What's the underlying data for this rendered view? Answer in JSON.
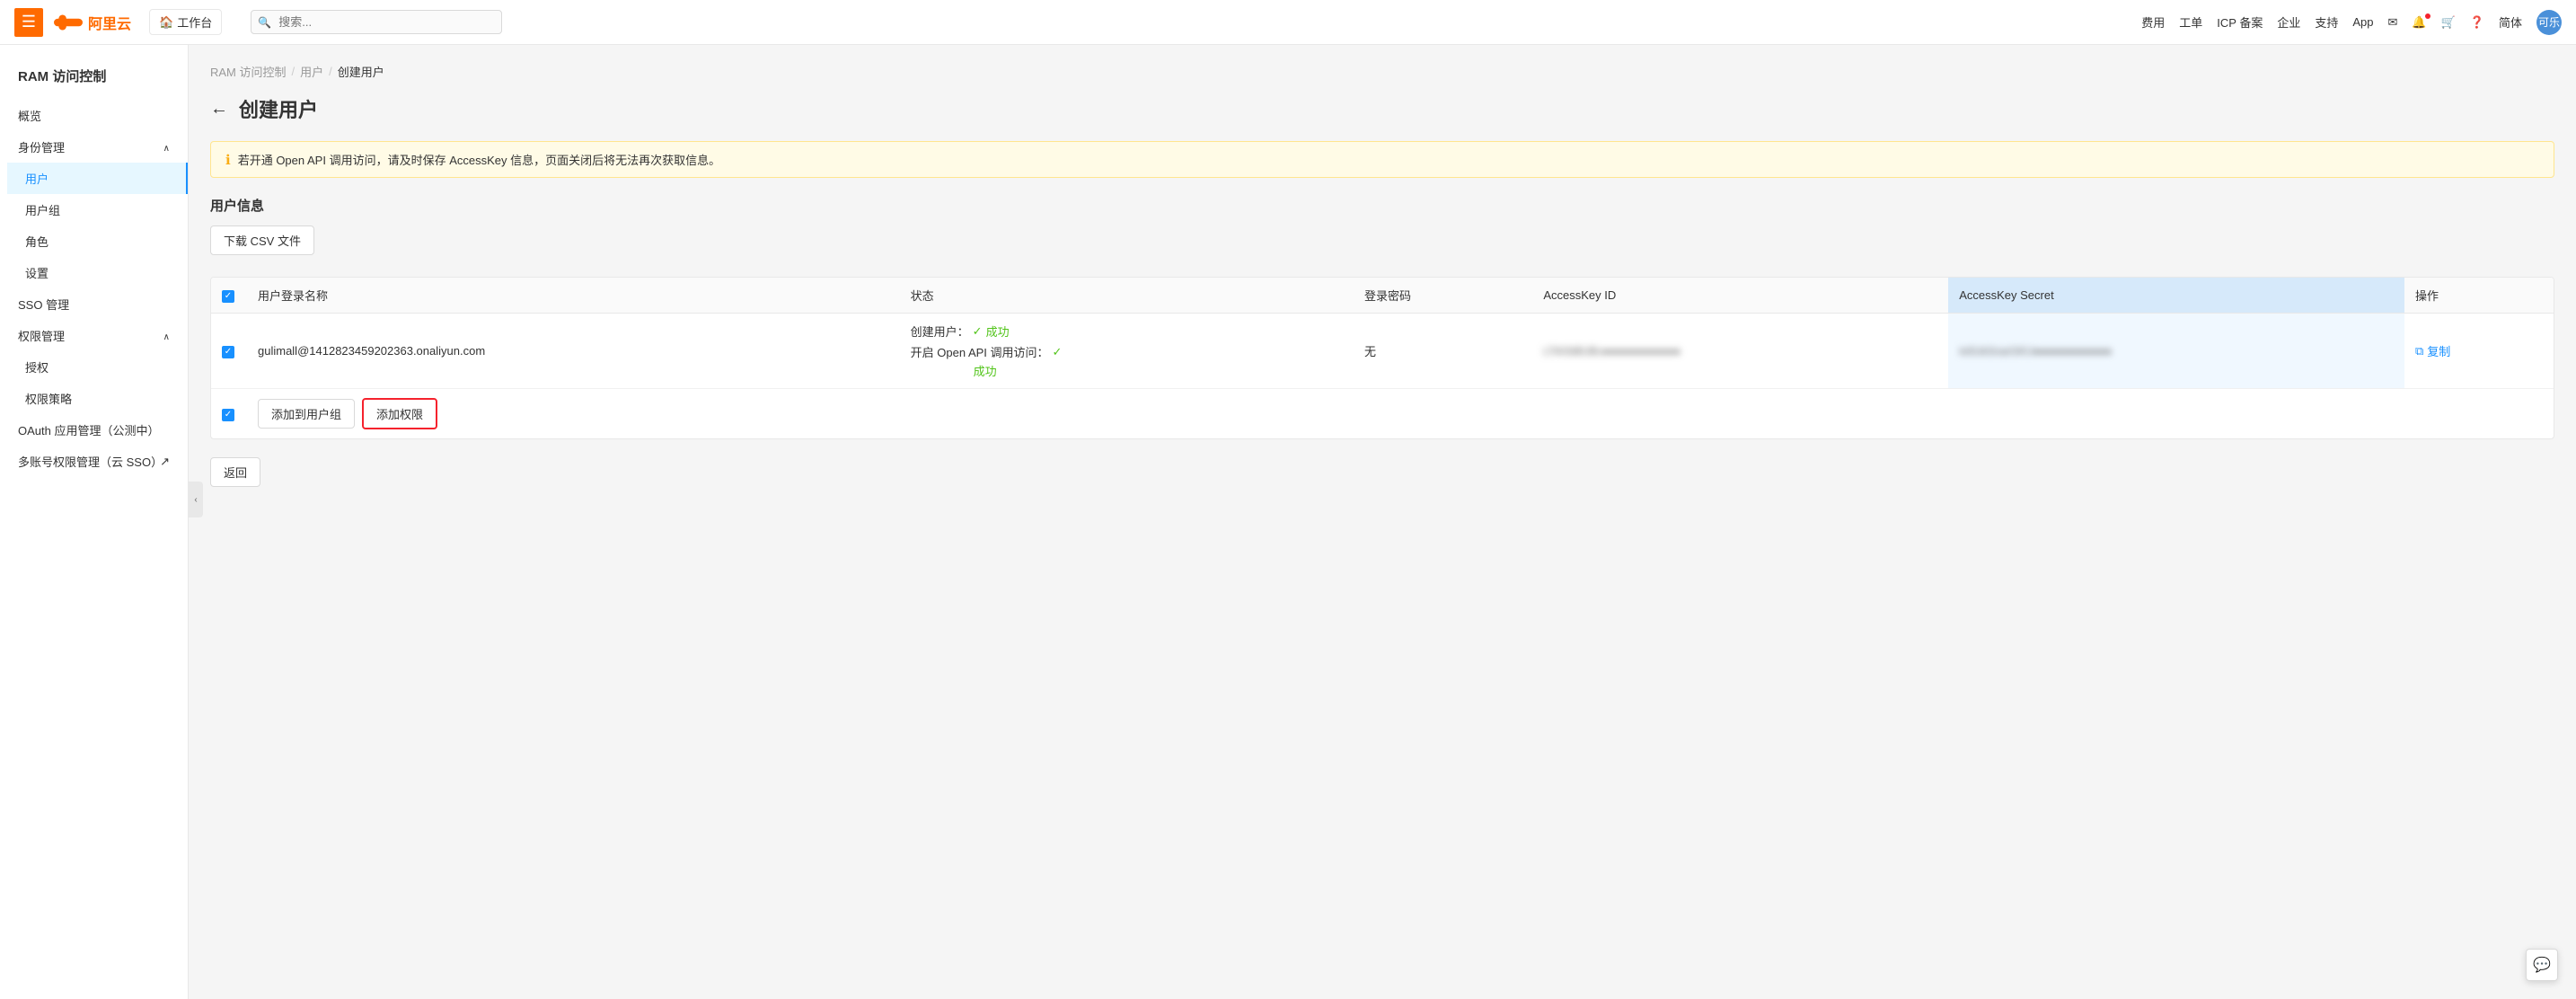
{
  "browser": {
    "url": "ram.console.aliyun.com/users/new"
  },
  "topnav": {
    "hamburger_icon": "☰",
    "logo_text": "阿里云",
    "workbench_label": "工作台",
    "search_placeholder": "搜索...",
    "nav_items": [
      "费用",
      "工单",
      "ICP 备案",
      "企业",
      "支持",
      "App"
    ],
    "simplified_label": "简体",
    "avatar_text": "可乐"
  },
  "sidebar": {
    "title": "RAM 访问控制",
    "overview_label": "概览",
    "identity_section": "身份管理",
    "users_label": "用户",
    "user_groups_label": "用户组",
    "roles_label": "角色",
    "settings_label": "设置",
    "sso_label": "SSO 管理",
    "permissions_section": "权限管理",
    "authorization_label": "授权",
    "permission_policy_label": "权限策略",
    "oauth_label": "OAuth 应用管理（公测中）",
    "multi_account_label": "多账号权限管理（云 SSO）",
    "external_icon": "↗"
  },
  "breadcrumb": {
    "root": "RAM 访问控制",
    "sep1": "/",
    "users": "用户",
    "sep2": "/",
    "current": "创建用户"
  },
  "page": {
    "back_arrow": "←",
    "title": "创建用户"
  },
  "warning": {
    "icon": "●",
    "text": "若开通 Open API 调用访问，请及时保存 AccessKey 信息，页面关闭后将无法再次获取信息。"
  },
  "section": {
    "title": "用户信息"
  },
  "download_btn": "下载 CSV 文件",
  "table": {
    "headers": [
      "用户登录名称",
      "状态",
      "登录密码",
      "AccessKey ID",
      "AccessKey Secret",
      "操作"
    ],
    "row": {
      "username": "gulimall@1412823459202363.onaliyun.com",
      "status_line1": "创建用户：",
      "status_check1": "✓",
      "status_success1": "成功",
      "status_line2": "开启 Open API 调用访问：",
      "status_check2": "✓",
      "status_success2": "成功",
      "password": "无",
      "accesskey_id": "LTAIStBUBc●●●●●●●●●●●●",
      "accesskey_secret_blurred": "Ie5UkSnarGKU●●●●●●●●●●●●",
      "copy_icon": "⧉",
      "copy_label": "复制"
    }
  },
  "action_row": {
    "add_to_group_label": "添加到用户组",
    "add_permission_label": "添加权限"
  },
  "footer": {
    "back_label": "返回"
  }
}
